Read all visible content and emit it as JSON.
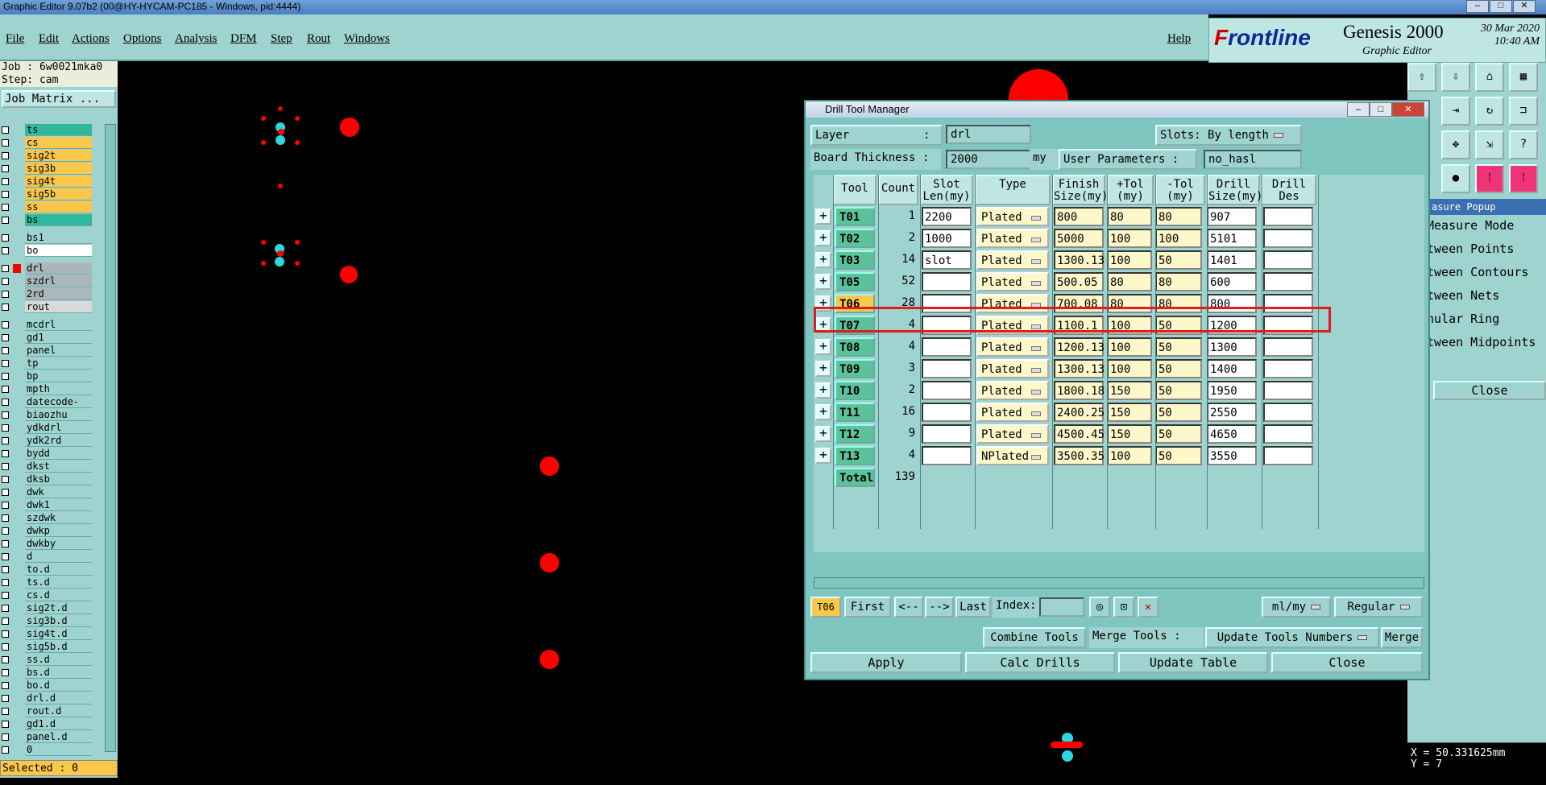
{
  "window": {
    "title": "Graphic Editor 9.07b2 (00@HY-HYCAM-PC185 - Windows, pid:4444)"
  },
  "menu": [
    "File",
    "Edit",
    "Actions",
    "Options",
    "Analysis",
    "DFM",
    "Step",
    "Rout",
    "Windows"
  ],
  "help": "Help",
  "logo": {
    "brand_a": "F",
    "brand_b": "rontline",
    "product": "Genesis 2000",
    "subtitle": "Graphic Editor",
    "date": "30 Mar 2020",
    "time": "10:40 AM"
  },
  "left_panel": {
    "job": "Job : 6w0021mka0",
    "step": "Step: cam",
    "job_matrix": "Job Matrix ...",
    "layers": [
      {
        "name": "ts",
        "color": "#2fb99a"
      },
      {
        "name": "cs",
        "color": "#f9c74a"
      },
      {
        "name": "sig2t",
        "color": "#f9c74a"
      },
      {
        "name": "sig3b",
        "color": "#f9c74a"
      },
      {
        "name": "sig4t",
        "color": "#f9c74a"
      },
      {
        "name": "sig5b",
        "color": "#f9c74a"
      },
      {
        "name": "ss",
        "color": "#f9c74a"
      },
      {
        "name": "bs",
        "color": "#2fb99a"
      },
      {
        "name": "bs1",
        "color": "#9ed3cf"
      },
      {
        "name": "bo",
        "color": "#ffffff"
      },
      {
        "name": "drl",
        "color": "#aab5bc"
      },
      {
        "name": "szdrl",
        "color": "#aab5bc"
      },
      {
        "name": "2rd",
        "color": "#aab5bc"
      },
      {
        "name": "rout",
        "color": "#d9d9d9"
      },
      {
        "name": "mcdrl",
        "color": "#9ed3cf"
      },
      {
        "name": "gd1",
        "color": "#9ed3cf"
      },
      {
        "name": "panel",
        "color": "#9ed3cf"
      },
      {
        "name": "tp",
        "color": "#9ed3cf"
      },
      {
        "name": "bp",
        "color": "#9ed3cf"
      },
      {
        "name": "mpth",
        "color": "#9ed3cf"
      },
      {
        "name": "datecode-pte",
        "color": "#9ed3cf"
      },
      {
        "name": "biaozhu",
        "color": "#9ed3cf"
      },
      {
        "name": "ydkdrl",
        "color": "#9ed3cf"
      },
      {
        "name": "ydk2rd",
        "color": "#9ed3cf"
      },
      {
        "name": "bydd",
        "color": "#9ed3cf"
      },
      {
        "name": "dkst",
        "color": "#9ed3cf"
      },
      {
        "name": "dksb",
        "color": "#9ed3cf"
      },
      {
        "name": "dwk",
        "color": "#9ed3cf"
      },
      {
        "name": "dwk1",
        "color": "#9ed3cf"
      },
      {
        "name": "szdwk",
        "color": "#9ed3cf"
      },
      {
        "name": "dwkp",
        "color": "#9ed3cf"
      },
      {
        "name": "dwkby",
        "color": "#9ed3cf"
      },
      {
        "name": "d",
        "color": "#9ed3cf"
      },
      {
        "name": "to.d",
        "color": "#9ed3cf"
      },
      {
        "name": "ts.d",
        "color": "#9ed3cf"
      },
      {
        "name": "cs.d",
        "color": "#9ed3cf"
      },
      {
        "name": "sig2t.d",
        "color": "#9ed3cf"
      },
      {
        "name": "sig3b.d",
        "color": "#9ed3cf"
      },
      {
        "name": "sig4t.d",
        "color": "#9ed3cf"
      },
      {
        "name": "sig5b.d",
        "color": "#9ed3cf"
      },
      {
        "name": "ss.d",
        "color": "#9ed3cf"
      },
      {
        "name": "bs.d",
        "color": "#9ed3cf"
      },
      {
        "name": "bo.d",
        "color": "#9ed3cf"
      },
      {
        "name": "drl.d",
        "color": "#9ed3cf"
      },
      {
        "name": "rout.d",
        "color": "#9ed3cf"
      },
      {
        "name": "gd1.d",
        "color": "#9ed3cf"
      },
      {
        "name": "panel.d",
        "color": "#9ed3cf"
      },
      {
        "name": "0",
        "color": "#9ed3cf"
      }
    ],
    "selected": "Selected : 0"
  },
  "dialog": {
    "title": "Drill Tool Manager",
    "layer_label": "Layer",
    "colon": ":",
    "layer_value": "drl",
    "slots_label": "Slots:",
    "slots_value": "By length",
    "board_thickness_label": "Board Thickness :",
    "board_thickness_value": "2000",
    "board_unit": "my",
    "user_params_label": "User Parameters :",
    "user_params_value": "no_hasl",
    "columns": [
      "Tool",
      "Count",
      "Slot Len(my)",
      "Type",
      "Finish Size(my)",
      "+Tol (my)",
      "-Tol (my)",
      "Drill Size(my)",
      "Drill Des"
    ],
    "rows": [
      {
        "tool": "T01",
        "count": "1",
        "slot": "2200",
        "type": "Plated",
        "finish": "800",
        "ptol": "80",
        "mtol": "80",
        "drill": "907",
        "des": ""
      },
      {
        "tool": "T02",
        "count": "2",
        "slot": "1000",
        "type": "Plated",
        "finish": "5000",
        "ptol": "100",
        "mtol": "100",
        "drill": "5101",
        "des": ""
      },
      {
        "tool": "T03",
        "count": "14",
        "slot": "slot",
        "type": "Plated",
        "finish": "1300.13",
        "ptol": "100",
        "mtol": "50",
        "drill": "1401",
        "des": ""
      },
      {
        "tool": "T05",
        "count": "52",
        "slot": "",
        "type": "Plated",
        "finish": "500.05",
        "ptol": "80",
        "mtol": "80",
        "drill": "600",
        "des": ""
      },
      {
        "tool": "T06",
        "count": "28",
        "slot": "",
        "type": "Plated",
        "finish": "700.08",
        "ptol": "80",
        "mtol": "80",
        "drill": "800",
        "des": ""
      },
      {
        "tool": "T07",
        "count": "4",
        "slot": "",
        "type": "Plated",
        "finish": "1100.1",
        "ptol": "100",
        "mtol": "50",
        "drill": "1200",
        "des": ""
      },
      {
        "tool": "T08",
        "count": "4",
        "slot": "",
        "type": "Plated",
        "finish": "1200.13",
        "ptol": "100",
        "mtol": "50",
        "drill": "1300",
        "des": ""
      },
      {
        "tool": "T09",
        "count": "3",
        "slot": "",
        "type": "Plated",
        "finish": "1300.13",
        "ptol": "100",
        "mtol": "50",
        "drill": "1400",
        "des": ""
      },
      {
        "tool": "T10",
        "count": "2",
        "slot": "",
        "type": "Plated",
        "finish": "1800.18",
        "ptol": "150",
        "mtol": "50",
        "drill": "1950",
        "des": ""
      },
      {
        "tool": "T11",
        "count": "16",
        "slot": "",
        "type": "Plated",
        "finish": "2400.25",
        "ptol": "150",
        "mtol": "50",
        "drill": "2550",
        "des": ""
      },
      {
        "tool": "T12",
        "count": "9",
        "slot": "",
        "type": "Plated",
        "finish": "4500.45",
        "ptol": "150",
        "mtol": "50",
        "drill": "4650",
        "des": ""
      },
      {
        "tool": "T13",
        "count": "4",
        "slot": "",
        "type": "NPlated",
        "finish": "3500.35",
        "ptol": "100",
        "mtol": "50",
        "drill": "3550",
        "des": ""
      }
    ],
    "total_label": "Total",
    "total_value": "139",
    "current_tool": "T06",
    "nav": {
      "first": "First",
      "prev": "<--",
      "next": "-->",
      "last": "Last",
      "index": "Index:"
    },
    "units": "ml/my",
    "mode": "Regular",
    "combine": "Combine Tools",
    "merge_tools_label": "Merge Tools :",
    "merge_option": "Update Tools Numbers",
    "merge": "Merge",
    "apply": "Apply",
    "calc": "Calc Drills",
    "update": "Update Table",
    "close": "Close"
  },
  "measure_popup": {
    "title": "asure Popup",
    "mode": "Measure Mode",
    "items": [
      "tween Points",
      "tween Contours",
      "tween Nets",
      "nular Ring",
      "tween Midpoints"
    ],
    "close": "Close"
  },
  "coords": {
    "x": "X = 50.331625mm",
    "y": "Y = 7"
  },
  "colors": {
    "panel_bg": "#9ed3cf",
    "accent": "#f9c74a",
    "highlight": "#e01d1d",
    "pad_red": "#ff0000",
    "pad_cyan": "#2cd8e0"
  }
}
